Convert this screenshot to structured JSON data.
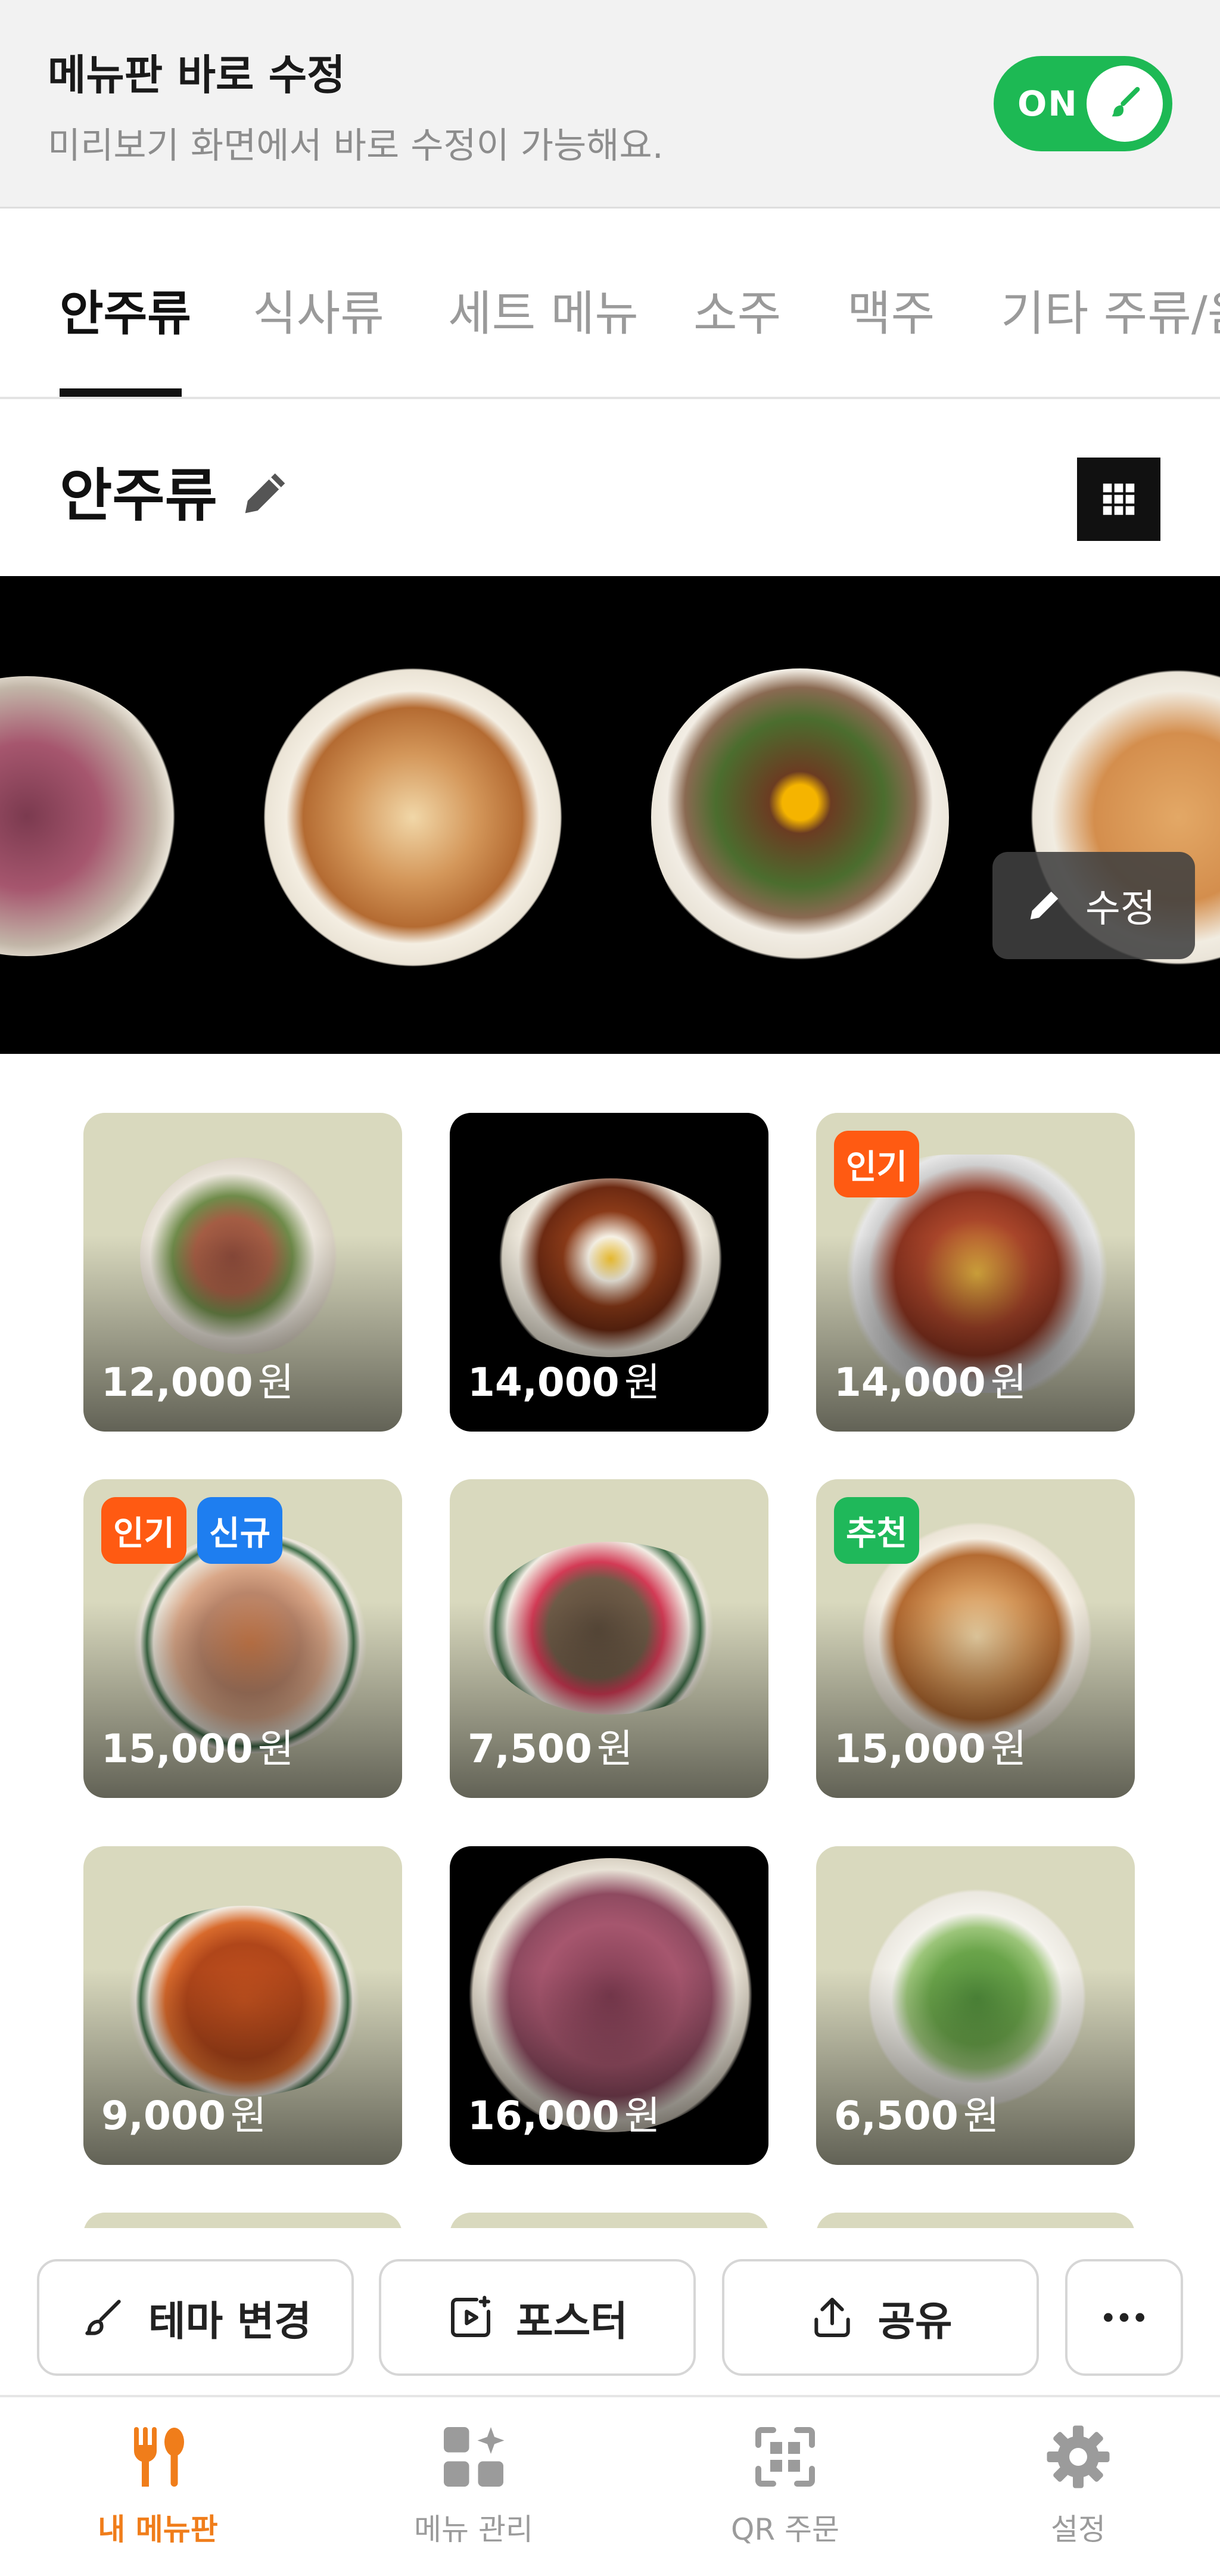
{
  "banner": {
    "title": "메뉴판 바로 수정",
    "subtitle": "미리보기 화면에서 바로 수정이 가능해요.",
    "toggle_label": "ON",
    "toggle_color": "#1db954"
  },
  "categories": [
    {
      "label": "안주류",
      "active": true
    },
    {
      "label": "식사류",
      "active": false
    },
    {
      "label": "세트 메뉴",
      "active": false
    },
    {
      "label": "소주",
      "active": false
    },
    {
      "label": "맥주",
      "active": false
    },
    {
      "label": "기타 주류/음",
      "active": false
    }
  ],
  "section": {
    "title": "안주류",
    "edit_icon": "pencil-icon",
    "view_icon": "grid-icon"
  },
  "hero": {
    "edit_label": "수정"
  },
  "menu_items": [
    {
      "price": "12,000",
      "unit": "원",
      "badges": [],
      "bg": "light"
    },
    {
      "price": "14,000",
      "unit": "원",
      "badges": [],
      "bg": "dark"
    },
    {
      "price": "14,000",
      "unit": "원",
      "badges": [
        {
          "label": "인기",
          "color": "#ff5a12"
        }
      ],
      "bg": "light"
    },
    {
      "price": "15,000",
      "unit": "원",
      "badges": [
        {
          "label": "인기",
          "color": "#ff5a12"
        },
        {
          "label": "신규",
          "color": "#1e7ef0"
        }
      ],
      "bg": "light"
    },
    {
      "price": "7,500",
      "unit": "원",
      "badges": [],
      "bg": "light"
    },
    {
      "price": "15,000",
      "unit": "원",
      "badges": [
        {
          "label": "추천",
          "color": "#1fb85a"
        }
      ],
      "bg": "light"
    },
    {
      "price": "9,000",
      "unit": "원",
      "badges": [],
      "bg": "light"
    },
    {
      "price": "16,000",
      "unit": "원",
      "badges": [],
      "bg": "dark"
    },
    {
      "price": "6,500",
      "unit": "원",
      "badges": [],
      "bg": "light"
    }
  ],
  "actions": {
    "theme": "테마 변경",
    "poster": "포스터",
    "share": "공유",
    "more_icon": "more-icon"
  },
  "tabbar": [
    {
      "label": "내 메뉴판",
      "icon": "fork-spoon-icon",
      "active": true
    },
    {
      "label": "메뉴 관리",
      "icon": "grid-sparkle-icon",
      "active": false
    },
    {
      "label": "QR 주문",
      "icon": "qr-icon",
      "active": false
    },
    {
      "label": "설정",
      "icon": "gear-icon",
      "active": false
    }
  ],
  "colors": {
    "accent": "#f07d1a",
    "toggle_on": "#1db954",
    "dark": "#111111",
    "card_bg": "#d9d9be"
  }
}
